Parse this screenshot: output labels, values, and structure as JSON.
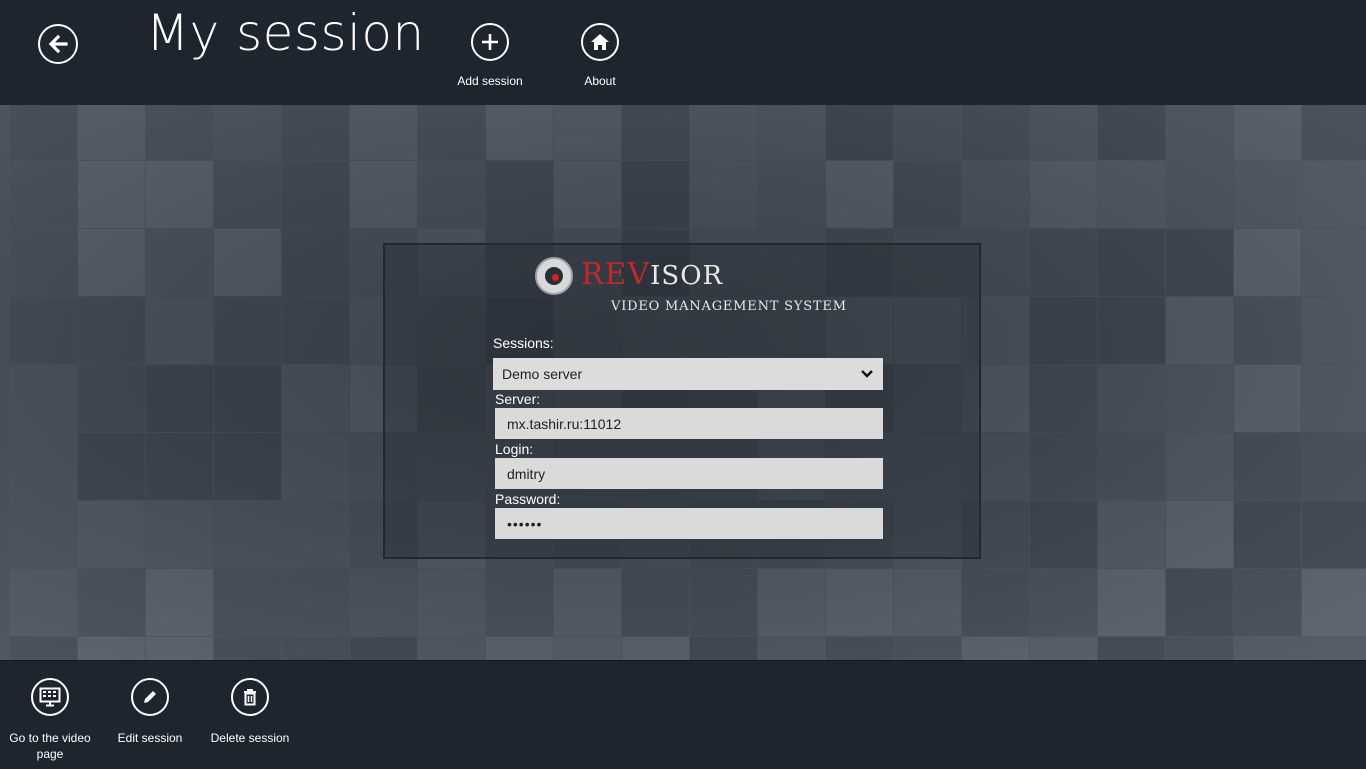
{
  "header": {
    "title": "My session",
    "buttons": {
      "back_icon": "back-arrow-icon",
      "add_session": "Add session",
      "about": "About"
    }
  },
  "logo": {
    "brand_red": "REV",
    "brand_white": "ISOR",
    "subtitle": "VIDEO MANAGEMENT SYSTEM"
  },
  "form": {
    "sessions_label": "Sessions:",
    "sessions_value": "Demo server",
    "server_label": "Server:",
    "server_value": "mx.tashir.ru:11012",
    "login_label": "Login:",
    "login_value": "dmitry",
    "password_label": "Password:",
    "password_value": "••••••"
  },
  "appbar": {
    "go_video": "Go to the video page",
    "edit_session": "Edit session",
    "delete_session": "Delete session"
  },
  "colors": {
    "bar_bg": "#1e252f",
    "content_bg": "#4a525c",
    "input_bg": "#dadada",
    "brand_red": "#c3262b"
  }
}
